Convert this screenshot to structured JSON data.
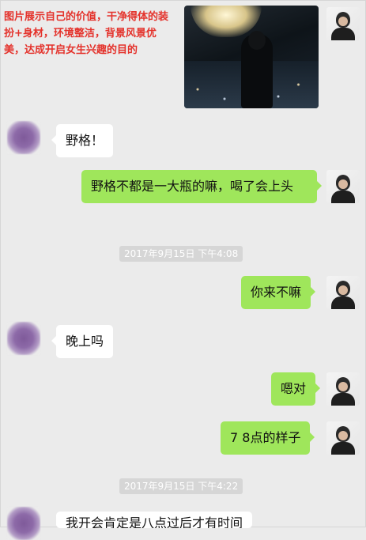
{
  "annotation": {
    "text": "图片展示自己的价值，干净得体的装扮+身材，环境整洁，背景风景优美，达成开启女生兴趣的目的"
  },
  "messages": [
    {
      "side": "out",
      "type": "image"
    },
    {
      "side": "in",
      "text": "野格！"
    },
    {
      "side": "out",
      "text": "野格不都是一大瓶的嘛，喝了会上头"
    },
    {
      "side": "out",
      "text": "你来不嘛"
    },
    {
      "side": "in",
      "text": "晚上吗"
    },
    {
      "side": "out",
      "text": "嗯对"
    },
    {
      "side": "out",
      "text": "7 8点的样子"
    },
    {
      "side": "in",
      "text": "我开会肯定是八点过后才有时间"
    }
  ],
  "timestamps": [
    "2017年9月15日 下午4:08",
    "2017年9月15日 下午4:22"
  ],
  "colors": {
    "background": "#ebebeb",
    "outgoing_bubble": "#9fe65b",
    "incoming_bubble": "#ffffff",
    "annotation_text": "#e4322b"
  },
  "icons": [
    "self-avatar",
    "contact-avatar"
  ]
}
